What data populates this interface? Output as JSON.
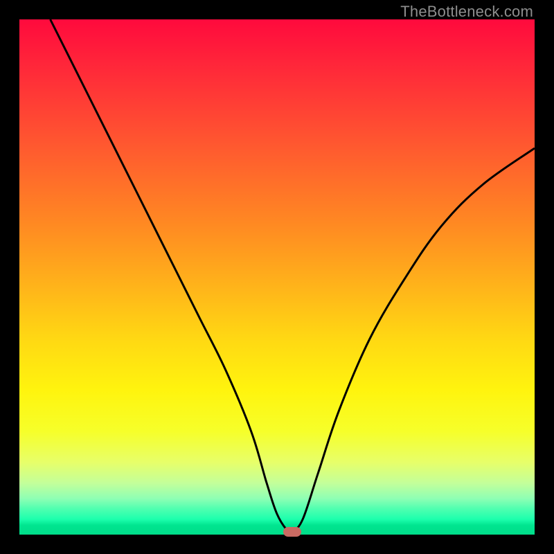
{
  "watermark": "TheBottleneck.com",
  "colors": {
    "frame": "#000000",
    "curve": "#000000",
    "marker": "#c96a62"
  },
  "chart_data": {
    "type": "line",
    "title": "",
    "xlabel": "",
    "ylabel": "",
    "xlim": [
      0,
      100
    ],
    "ylim": [
      0,
      100
    ],
    "grid": false,
    "legend": false,
    "note": "V-shaped bottleneck curve over a vertical red→green gradient. x is normalized position across the plot (0 at left, 100 at right); y is normalized height (0 at bottom green band, 100 at top red). Values estimated from pixel positions.",
    "series": [
      {
        "name": "bottleneck-curve",
        "x": [
          6,
          10,
          15,
          20,
          25,
          30,
          35,
          40,
          45,
          48,
          50,
          52,
          53,
          55,
          58,
          62,
          68,
          75,
          82,
          90,
          100
        ],
        "y": [
          100,
          92,
          82,
          72,
          62,
          52,
          42,
          32,
          20,
          10,
          4,
          0.8,
          0.6,
          3,
          12,
          24,
          38,
          50,
          60,
          68,
          75
        ]
      }
    ],
    "marker": {
      "x": 53,
      "y": 0.6,
      "shape": "capsule"
    },
    "background_gradient_stops": [
      {
        "pos": 0.0,
        "color": "#ff0a3d"
      },
      {
        "pos": 0.25,
        "color": "#ff5a2f"
      },
      {
        "pos": 0.52,
        "color": "#ffb41a"
      },
      {
        "pos": 0.72,
        "color": "#fff40e"
      },
      {
        "pos": 0.9,
        "color": "#c3ff9a"
      },
      {
        "pos": 1.0,
        "color": "#00dd8a"
      }
    ]
  }
}
